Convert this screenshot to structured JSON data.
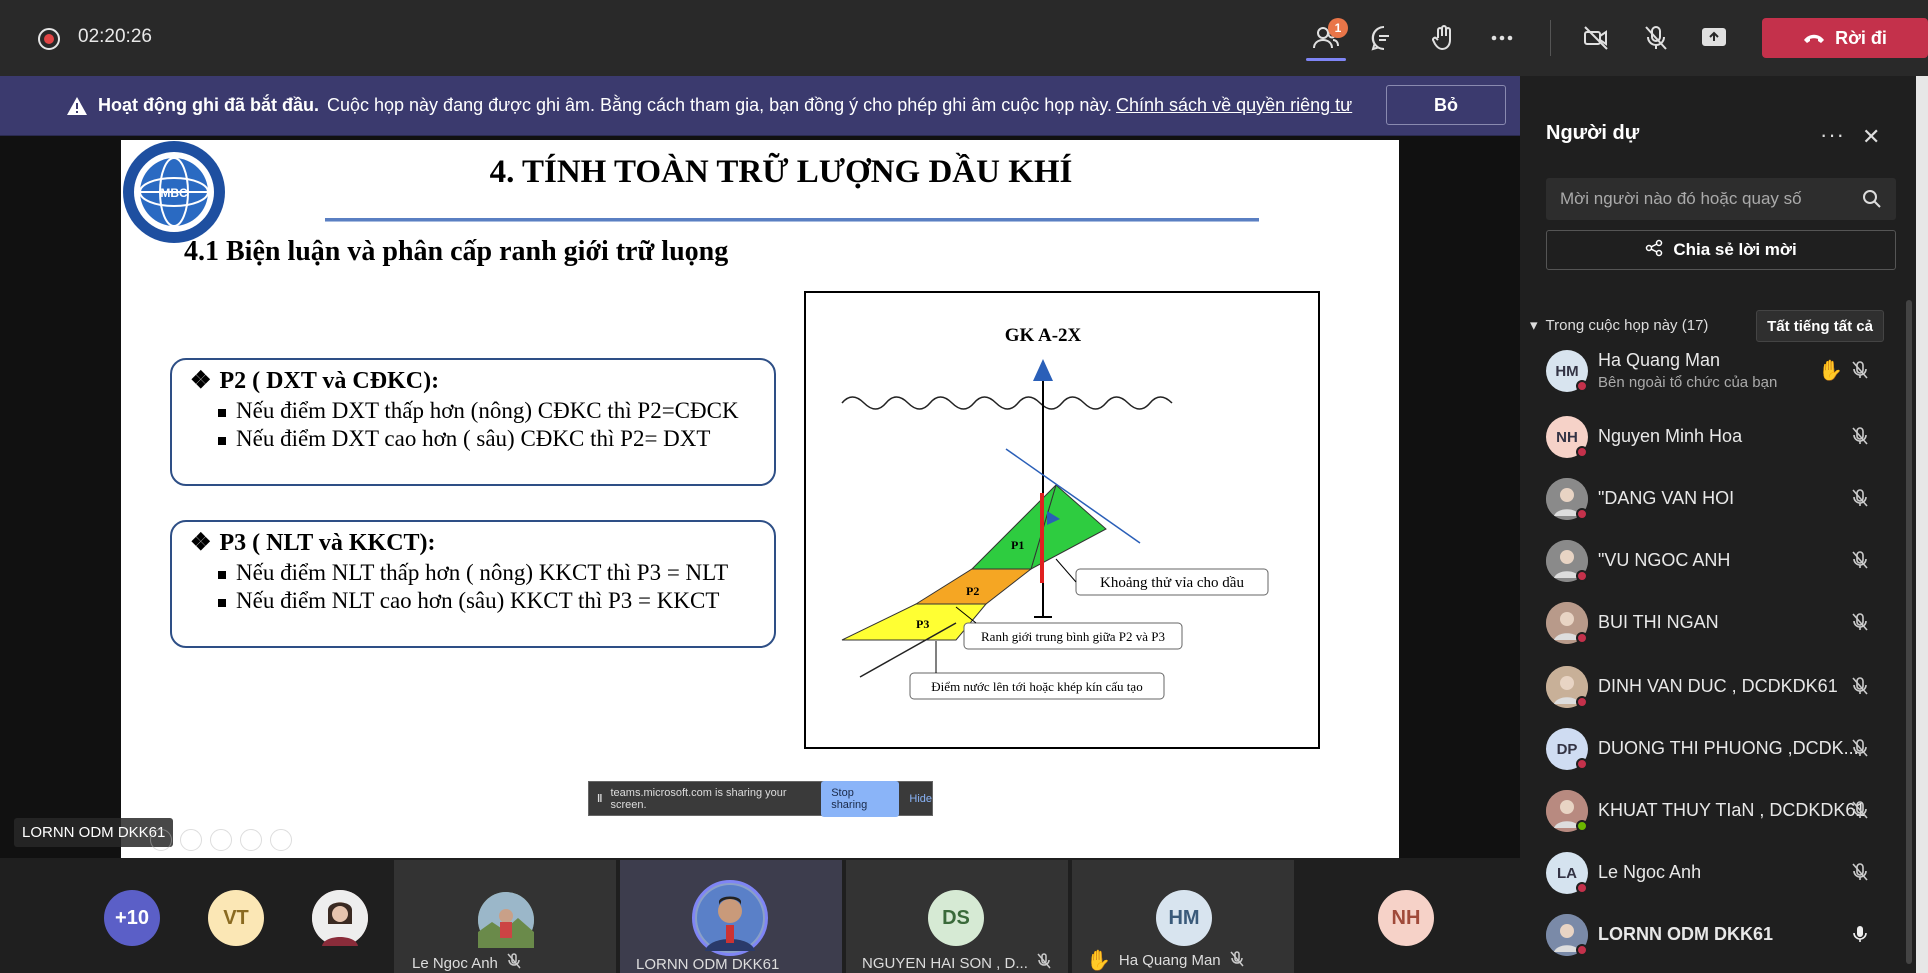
{
  "toolbar": {
    "timer": "02:20:26",
    "people_badge": "1",
    "leave_label": "Rời đi"
  },
  "banner": {
    "title": "Hoạt động ghi đã bắt đầu.",
    "message": "Cuộc họp này đang được ghi âm. Bằng cách tham gia, bạn đồng ý cho phép ghi âm cuộc họp này.",
    "link": "Chính sách về quyền riêng tư",
    "dismiss": "Bỏ"
  },
  "slide": {
    "title": "4. TÍNH TOÀN TRỮ LƯỢNG DẦU KHÍ",
    "subheading": "4.1 Biện luận và phân cấp ranh giới trữ luọng",
    "logo_text": "MBC",
    "box1": {
      "head": "P2 ( DXT và CĐKC):",
      "items": [
        "Nếu điểm DXT thấp hơn (nông) CĐKC thì P2=CĐCK",
        "Nếu điểm DXT cao hơn ( sâu) CĐKC thì P2= DXT"
      ]
    },
    "box2": {
      "head": "P3 ( NLT và KKCT):",
      "items": [
        "Nếu điểm NLT thấp hơn ( nông) KKCT thì P3 = NLT",
        "Nếu điểm NLT cao hơn (sâu) KKCT thì P3 = KKCT"
      ]
    },
    "figure": {
      "well_label": "GK A-2X",
      "p1": "P1",
      "p2": "P2",
      "p3": "P3",
      "label_interval": "Khoảng thử vỉa cho dầu",
      "label_boundary": "Ranh giới trung bình giữa P2 và P3",
      "label_water": "Điểm nước lên tới hoặc khép kín cấu tạo"
    }
  },
  "share_bar": {
    "message": "teams.microsoft.com is sharing your screen.",
    "stop": "Stop sharing",
    "hide": "Hide"
  },
  "presenter_label": "LORNN ODM DKK61",
  "gallery": [
    {
      "initials": "+10",
      "color": "#5b5fc7"
    },
    {
      "initials": "VT",
      "color": "#fbe7b5"
    },
    {
      "initials": "",
      "color": "#c9a0a0"
    },
    {
      "name": "Le Ngoc Anh"
    },
    {
      "name": "LORNN ODM DKK61"
    },
    {
      "initials": "DS",
      "name": "NGUYEN HAI SON , D...",
      "color": "#d6ead4"
    },
    {
      "initials": "HM",
      "name": "Ha Quang Man",
      "color": "#d8e4ef"
    },
    {
      "initials": "NH",
      "color": "#f6d2c8"
    }
  ],
  "panel": {
    "title": "Người dự",
    "invite_placeholder": "Mời người nào đó hoặc quay số",
    "share_invite": "Chia sẻ lời mời",
    "section": "Trong cuộc họp này (17)",
    "mute_all": "Tất tiếng tất cả",
    "people": [
      {
        "initials": "HM",
        "name": "Ha Quang Man",
        "sub": "Bên ngoài tổ chức của bạn",
        "color": "#d8e4ef",
        "hand": true
      },
      {
        "initials": "NH",
        "name": "Nguyen Minh Hoa",
        "color": "#f6d2c8"
      },
      {
        "initials": "",
        "name": "\"DANG VAN HOI",
        "color": "#8a8a8a"
      },
      {
        "initials": "",
        "name": "\"VU NGOC ANH",
        "color": "#8a8a8a"
      },
      {
        "initials": "",
        "name": "BUI THI NGAN",
        "color": "#b89a8a"
      },
      {
        "initials": "",
        "name": "DINH VAN DUC , DCDKDK61",
        "color": "#c8b098"
      },
      {
        "initials": "DP",
        "name": "DUONG THI PHUONG ,DCDK...",
        "color": "#cfdcf2"
      },
      {
        "initials": "",
        "name": "KHUAT THUY TIaN , DCDKDK61",
        "color": "#b88a80"
      },
      {
        "initials": "LA",
        "name": "Le Ngoc Anh",
        "color": "#d5e3ef"
      },
      {
        "initials": "",
        "name": "LORNN ODM DKK61",
        "color": "#7a8aa8"
      }
    ]
  }
}
